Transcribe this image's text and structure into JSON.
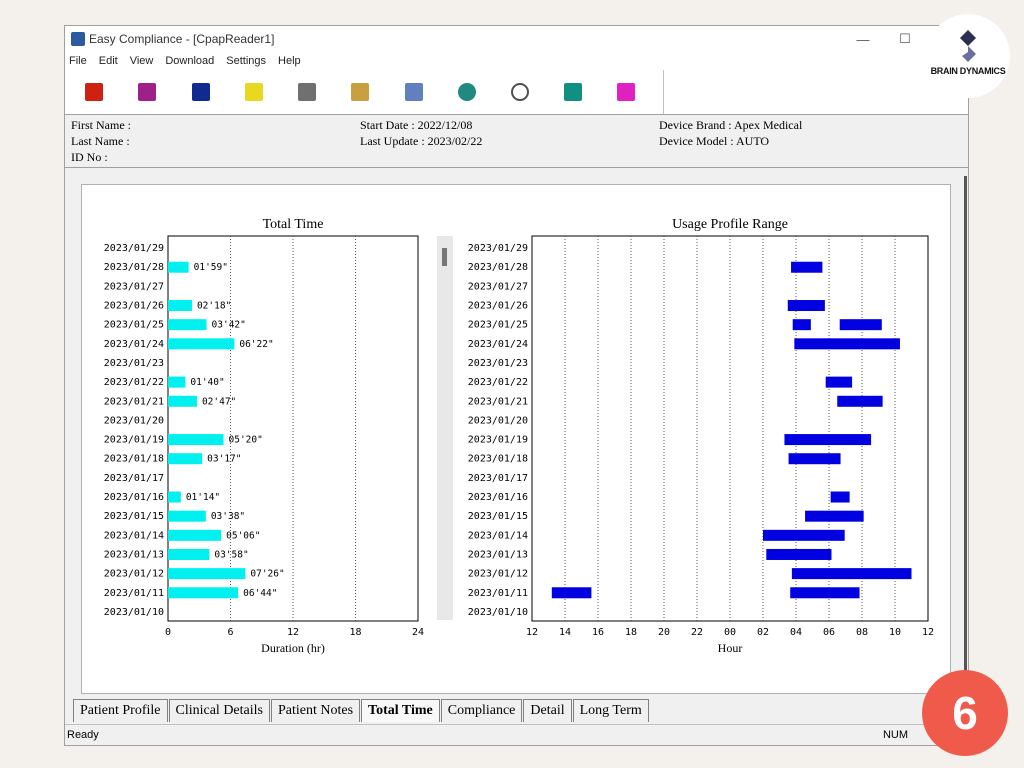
{
  "window": {
    "title": "Easy Compliance - [CpapReader1]",
    "minimize": "—",
    "maximize": "☐"
  },
  "menu": [
    "File",
    "Edit",
    "View",
    "Download",
    "Settings",
    "Help"
  ],
  "toolbar": {
    "icons": [
      {
        "name": "new-patient-icon",
        "color": "#d02010"
      },
      {
        "name": "open-book-icon",
        "color": "#a0208a"
      },
      {
        "name": "save-disk-icon",
        "color": "#102a90"
      },
      {
        "name": "notepad-edit-icon",
        "color": "#e8d820"
      },
      {
        "name": "printer-icon",
        "color": "#707070"
      },
      {
        "name": "monitor-icon",
        "color": "#c8a040"
      },
      {
        "name": "download-device-icon",
        "color": "#6080c0"
      },
      {
        "name": "user-profile-icon",
        "color": "#208a80"
      },
      {
        "name": "clock-icon",
        "color": "#505050"
      },
      {
        "name": "telephone-icon",
        "color": "#109080"
      },
      {
        "name": "help-book-icon",
        "color": "#e020c0"
      }
    ]
  },
  "patient": {
    "first_name": "First Name :",
    "last_name": "Last Name :",
    "id_no": "ID No :",
    "start_date": "Start Date : 2022/12/08",
    "last_update": "Last Update : 2023/02/22",
    "device_brand": "Device Brand : Apex Medical",
    "device_model": "Device Model : AUTO"
  },
  "chart_data": [
    {
      "type": "bar",
      "orientation": "horizontal",
      "title": "Total Time",
      "xlabel": "Duration (hr)",
      "ylabel": "",
      "xlim": [
        0,
        24
      ],
      "xticks": [
        0,
        6,
        12,
        18,
        24
      ],
      "categories": [
        "2023/01/29",
        "2023/01/28",
        "2023/01/27",
        "2023/01/26",
        "2023/01/25",
        "2023/01/24",
        "2023/01/23",
        "2023/01/22",
        "2023/01/21",
        "2023/01/20",
        "2023/01/19",
        "2023/01/18",
        "2023/01/17",
        "2023/01/16",
        "2023/01/15",
        "2023/01/14",
        "2023/01/13",
        "2023/01/12",
        "2023/01/11",
        "2023/01/10"
      ],
      "values": [
        null,
        1.98,
        null,
        2.3,
        3.7,
        6.37,
        null,
        1.67,
        2.78,
        null,
        5.33,
        3.28,
        null,
        1.23,
        3.63,
        5.1,
        3.97,
        7.43,
        6.73,
        null
      ],
      "labels": [
        "",
        "01'59\"",
        "",
        "02'18\"",
        "03'42\"",
        "06'22\"",
        "",
        "01'40\"",
        "02'47\"",
        "",
        "05'20\"",
        "03'17\"",
        "",
        "01'14\"",
        "03'38\"",
        "05'06\"",
        "03'58\"",
        "07'26\"",
        "06'44\"",
        ""
      ],
      "color": "#00f0f0",
      "grid": "vertical dotted"
    },
    {
      "type": "range-bar",
      "orientation": "horizontal",
      "title": "Usage Profile Range",
      "xlabel": "Hour",
      "ylabel": "",
      "xticks": [
        "12",
        "14",
        "16",
        "18",
        "20",
        "22",
        "00",
        "02",
        "04",
        "06",
        "08",
        "10",
        "12"
      ],
      "xlim_hours_from_noon": [
        0,
        24
      ],
      "categories": [
        "2023/01/29",
        "2023/01/28",
        "2023/01/27",
        "2023/01/26",
        "2023/01/25",
        "2023/01/24",
        "2023/01/23",
        "2023/01/22",
        "2023/01/21",
        "2023/01/20",
        "2023/01/19",
        "2023/01/18",
        "2023/01/17",
        "2023/01/16",
        "2023/01/15",
        "2023/01/14",
        "2023/01/13",
        "2023/01/12",
        "2023/01/11",
        "2023/01/10"
      ],
      "ranges": [
        [],
        [
          [
            15.7,
            17.6
          ]
        ],
        [],
        [
          [
            15.5,
            17.75
          ]
        ],
        [
          [
            15.8,
            16.9
          ],
          [
            18.65,
            21.2
          ]
        ],
        [
          [
            15.9,
            22.3
          ]
        ],
        [],
        [
          [
            17.8,
            19.4
          ]
        ],
        [
          [
            18.5,
            21.25
          ]
        ],
        [],
        [
          [
            15.3,
            20.55
          ]
        ],
        [
          [
            15.55,
            18.7
          ]
        ],
        [],
        [
          [
            18.1,
            19.25
          ]
        ],
        [
          [
            16.55,
            20.1
          ]
        ],
        [
          [
            14.0,
            18.95
          ]
        ],
        [
          [
            14.2,
            18.15
          ]
        ],
        [
          [
            15.75,
            23.0
          ]
        ],
        [
          [
            1.2,
            3.6
          ],
          [
            15.65,
            19.85
          ]
        ],
        []
      ],
      "color": "#0000e0",
      "grid": "vertical dotted"
    }
  ],
  "tabs": [
    "Patient Profile",
    "Clinical Details",
    "Patient Notes",
    "Total Time",
    "Compliance",
    "Detail",
    "Long Term"
  ],
  "active_tab": "Total Time",
  "status": {
    "ready": "Ready",
    "num": "NUM"
  },
  "logo": {
    "text": "BRAIN DYNAMICS"
  },
  "badge": {
    "text": "6"
  }
}
